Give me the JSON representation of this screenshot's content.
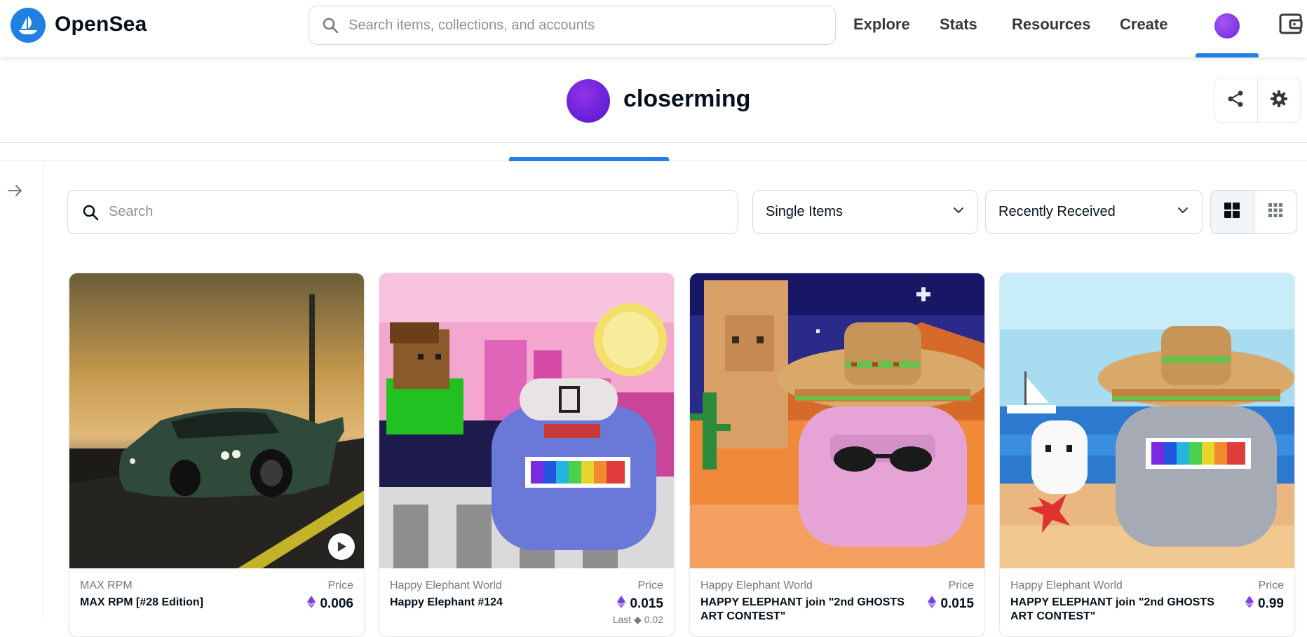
{
  "header": {
    "brand": "OpenSea",
    "search_placeholder": "Search items, collections, and accounts",
    "nav": [
      "Explore",
      "Stats",
      "Resources",
      "Create"
    ],
    "accent_color": "#2081e2"
  },
  "profile": {
    "username": "closerming",
    "avatar_color": "#7c3aed"
  },
  "toolbar": {
    "search_placeholder": "Search",
    "filter_selected": "Single Items",
    "sort_selected": "Recently Received"
  },
  "cards": [
    {
      "collection": "MAX RPM",
      "name": "MAX RPM [#28 Edition]",
      "price_label": "Price",
      "price": "0.006",
      "last": ""
    },
    {
      "collection": "Happy Elephant World",
      "name": "Happy Elephant #124",
      "price_label": "Price",
      "price": "0.015",
      "last": "Last ◆ 0.02"
    },
    {
      "collection": "Happy Elephant World",
      "name": "HAPPY ELEPHANT join \"2nd GHOSTS ART CONTEST\"",
      "price_label": "Price",
      "price": "0.015",
      "last": ""
    },
    {
      "collection": "Happy Elephant World",
      "name": "HAPPY ELEPHANT join \"2nd GHOSTS ART CONTEST\"",
      "price_label": "Price",
      "price": "0.99",
      "last": ""
    }
  ],
  "icons": {
    "currency": "eth-icon",
    "search": "search-icon",
    "share": "share-icon",
    "settings": "gear-icon",
    "sidebar_toggle": "arrow-right-icon",
    "grid_large": "grid-large-icon",
    "grid_small": "grid-small-icon",
    "wallet": "wallet-icon",
    "play": "play-icon"
  }
}
